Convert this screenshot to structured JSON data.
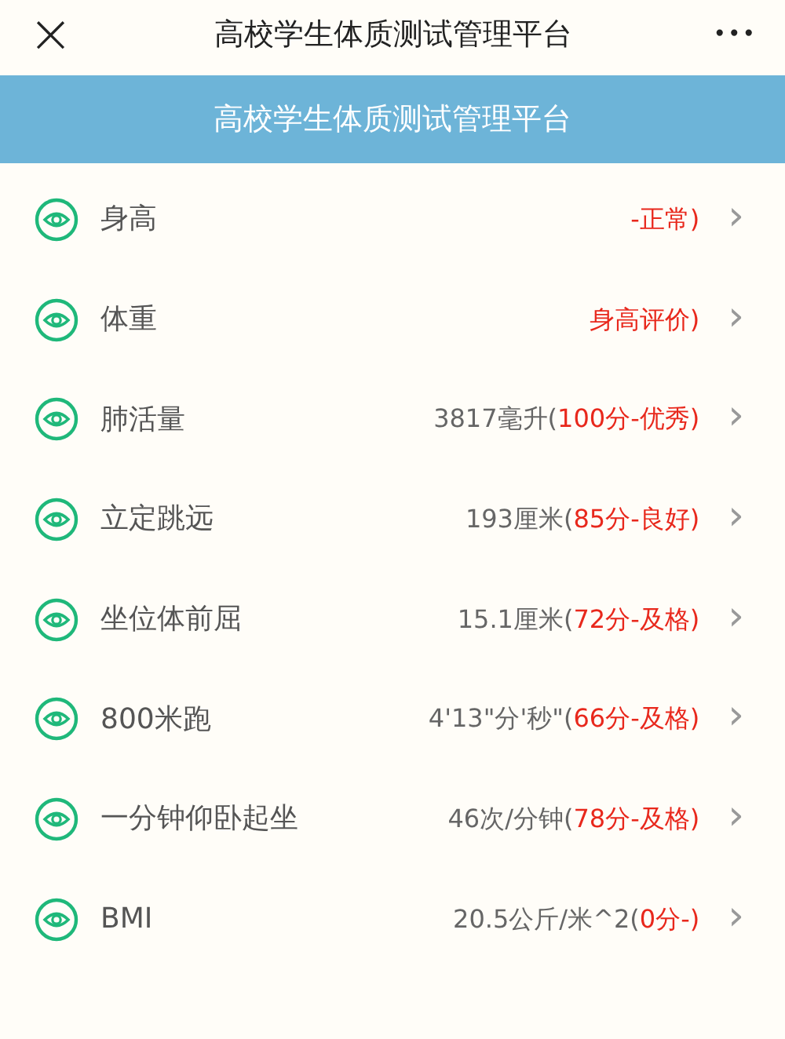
{
  "top_bar": {
    "close": "×",
    "title": "高校学生体质测试管理平台",
    "more": "•••"
  },
  "banner": {
    "title": "高校学生体质测试管理平台"
  },
  "items": [
    {
      "label": "身高",
      "score": "-正常)",
      "chevron": "›"
    },
    {
      "label": "体重",
      "score": "身高评价)",
      "chevron": "›"
    },
    {
      "label": "肺活量",
      "measure": "3817毫升(",
      "score": "100分-优秀)",
      "chevron": "›"
    },
    {
      "label": "立定跳远",
      "measure": "193厘米(",
      "score": "85分-良好)",
      "chevron": "›"
    },
    {
      "label": "坐位体前屈",
      "measure": "15.1厘米(",
      "score": "72分-及格)",
      "chevron": "›"
    },
    {
      "label": "800米跑",
      "measure": "4'13\"分'秒\"(",
      "score": "66分-及格)",
      "chevron": "›"
    },
    {
      "label": "一分钟仰卧起坐",
      "measure": "46次/分钟(",
      "score": "78分-及格)",
      "chevron": "›"
    },
    {
      "label": "BMI",
      "measure": "20.5公斤/米^2(",
      "score": "0分-)",
      "chevron": "›"
    }
  ]
}
